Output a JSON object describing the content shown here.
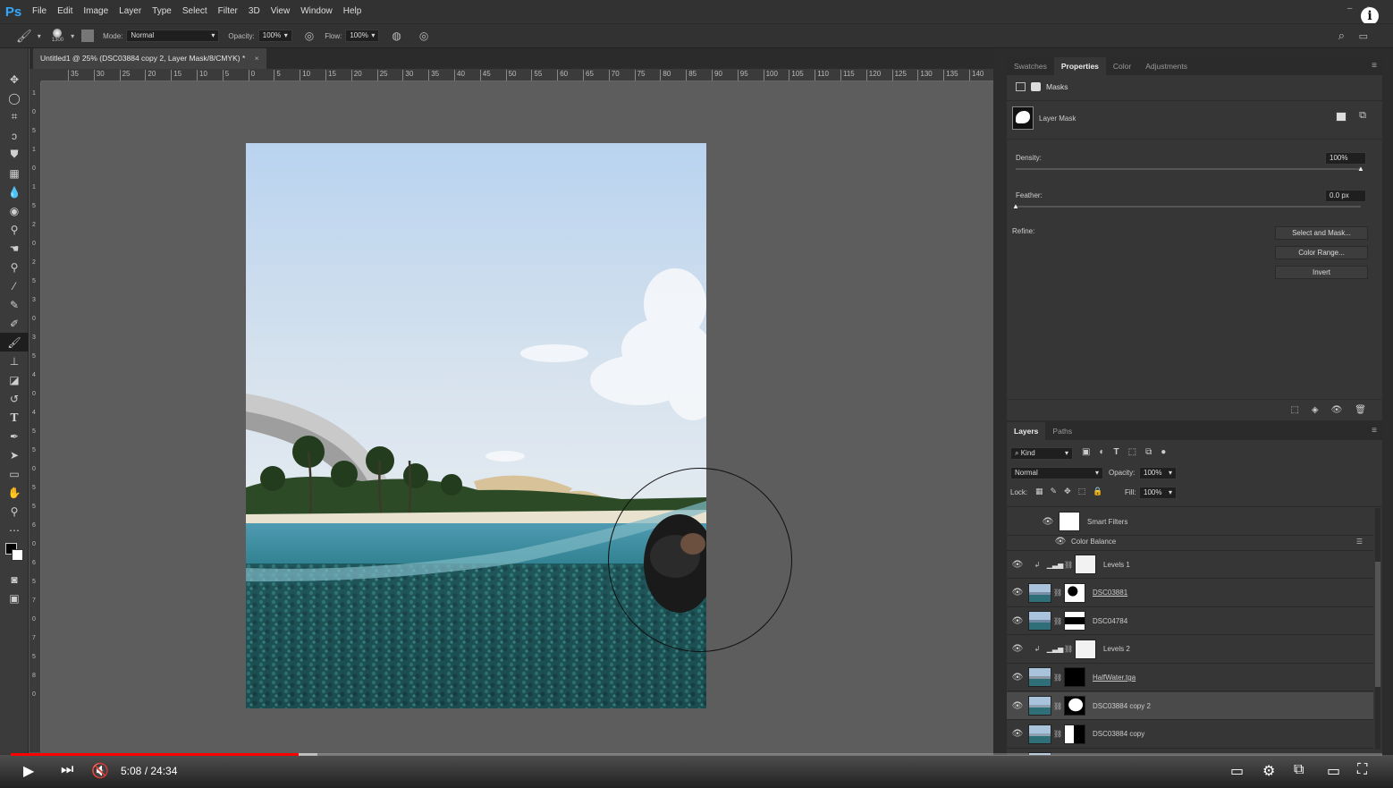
{
  "app": {
    "logo": "Ps",
    "menu": [
      "File",
      "Edit",
      "Image",
      "Layer",
      "Type",
      "Select",
      "Filter",
      "3D",
      "View",
      "Window",
      "Help"
    ]
  },
  "options": {
    "brush_size": "1300",
    "mode_label": "Mode:",
    "mode_value": "Normal",
    "opacity_label": "Opacity:",
    "opacity_value": "100%",
    "flow_label": "Flow:",
    "flow_value": "100%"
  },
  "document": {
    "tab_title": "Untitled1 @ 25% (DSC03884 copy 2, Layer Mask/8/CMYK) *",
    "close": "×"
  },
  "ruler": {
    "h_ticks": [
      "35",
      "30",
      "25",
      "20",
      "15",
      "10",
      "5",
      "0",
      "5",
      "10",
      "15",
      "20",
      "25",
      "30",
      "35",
      "40",
      "45",
      "50",
      "55",
      "60",
      "65",
      "70",
      "75",
      "80",
      "85",
      "90",
      "95",
      "100",
      "105",
      "110",
      "115",
      "120",
      "125",
      "130",
      "135",
      "140"
    ],
    "v_ticks": [
      "1",
      "0",
      "5",
      "1",
      "0",
      "1",
      "5",
      "2",
      "0",
      "2",
      "5",
      "3",
      "0",
      "3",
      "5",
      "4",
      "0",
      "4",
      "5",
      "5",
      "0",
      "5",
      "5",
      "6",
      "0",
      "6",
      "5",
      "7",
      "0",
      "7",
      "5",
      "8",
      "0"
    ]
  },
  "properties": {
    "tabs": [
      "Swatches",
      "Properties",
      "Color",
      "Adjustments"
    ],
    "active_tab": "Properties",
    "section": "Masks",
    "mask_label": "Layer Mask",
    "density_label": "Density:",
    "density_value": "100%",
    "feather_label": "Feather:",
    "feather_value": "0.0 px",
    "refine_label": "Refine:",
    "buttons": [
      "Select and Mask...",
      "Color Range...",
      "Invert"
    ]
  },
  "layers": {
    "tabs": [
      "Layers",
      "Paths"
    ],
    "kind_label": "Kind",
    "blend_mode": "Normal",
    "opacity_label": "Opacity:",
    "opacity_value": "100%",
    "lock_label": "Lock:",
    "fill_label": "Fill:",
    "fill_value": "100%",
    "smart_filters": "Smart Filters",
    "color_balance": "Color Balance",
    "items": [
      "Levels 1",
      "DSC03881",
      "DSC04784",
      "Levels 2",
      "HalfWater.tga",
      "DSC03884 copy 2",
      "DSC03884 copy",
      "DSC03884"
    ],
    "selected_index": 5
  },
  "video": {
    "time": "5:08 / 24:34",
    "progress": 0.21,
    "buffered": 0.224
  },
  "colors": {
    "accent": "#31a8ff",
    "progress": "#ff0000"
  }
}
